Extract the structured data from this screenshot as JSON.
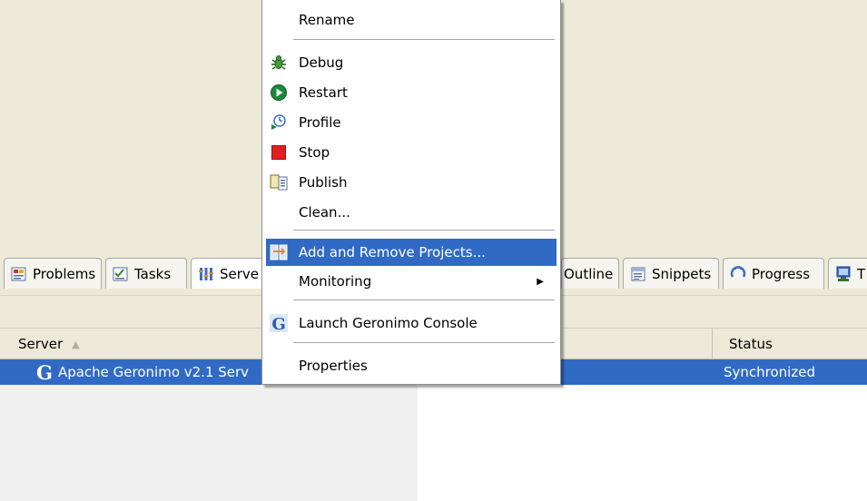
{
  "tabs": [
    {
      "label": "Problems",
      "icon": "problems-icon"
    },
    {
      "label": "Tasks",
      "icon": "tasks-icon"
    },
    {
      "label": "Serve",
      "icon": "servers-icon"
    },
    {
      "label": "Outline",
      "icon": "outline-icon"
    },
    {
      "label": "Snippets",
      "icon": "snippets-icon"
    },
    {
      "label": "Progress",
      "icon": "progress-icon"
    },
    {
      "label": "T",
      "icon": "terminal-icon"
    }
  ],
  "table": {
    "columns": [
      "Server",
      "Status"
    ],
    "rows": [
      {
        "server": "Apache Geronimo v2.1 Serv",
        "status": "Synchronized"
      }
    ]
  },
  "context_menu": {
    "items": [
      {
        "label": "Rename",
        "icon": ""
      },
      {
        "label": "Debug",
        "icon": "debug-icon"
      },
      {
        "label": "Restart",
        "icon": "restart-icon"
      },
      {
        "label": "Profile",
        "icon": "profile-icon"
      },
      {
        "label": "Stop",
        "icon": "stop-icon"
      },
      {
        "label": "Publish",
        "icon": "publish-icon"
      },
      {
        "label": "Clean...",
        "icon": ""
      },
      {
        "label": "Add and Remove Projects...",
        "icon": "add-remove-projects-icon"
      },
      {
        "label": "Monitoring",
        "icon": ""
      },
      {
        "label": "Launch Geronimo Console",
        "icon": "geronimo-icon"
      },
      {
        "label": "Properties",
        "icon": ""
      }
    ]
  },
  "colors": {
    "selection": "#316ac5",
    "panel_bg": "#ece9d8",
    "stop_red": "#e02020",
    "restart_green": "#1a8a3a"
  }
}
